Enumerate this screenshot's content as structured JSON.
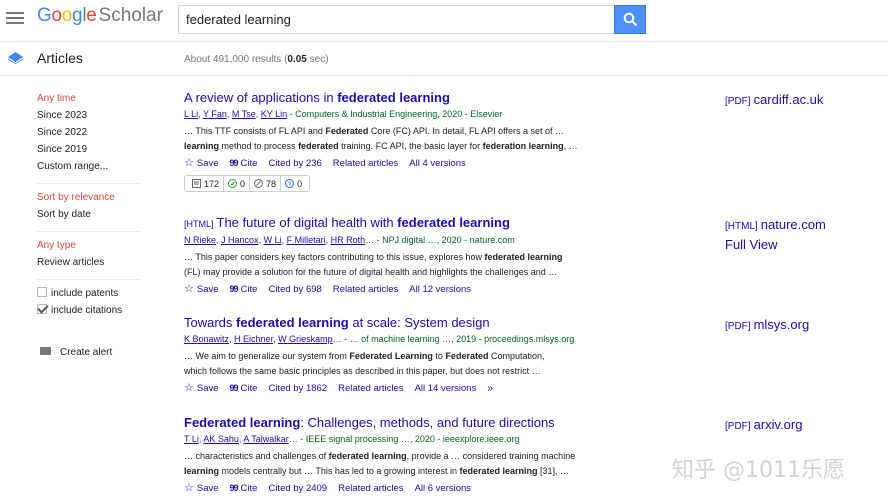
{
  "header": {
    "logo_google": "Google",
    "logo_scholar": "Scholar",
    "search_value": "federated learning"
  },
  "subheader": {
    "section": "Articles",
    "results_prefix": "About 491,000 results (",
    "results_time": "0.05",
    "results_suffix": " sec)"
  },
  "sidebar": {
    "time": [
      "Any time",
      "Since 2023",
      "Since 2022",
      "Since 2019",
      "Custom range..."
    ],
    "sort": [
      "Sort by relevance",
      "Sort by date"
    ],
    "type": [
      "Any type",
      "Review articles"
    ],
    "include_patents": "include patents",
    "include_citations": "include citations",
    "create_alert": "Create alert"
  },
  "results": [
    {
      "tag": "",
      "title_pre": "A review of applications in ",
      "title_bold": "federated learning",
      "title_post": "",
      "authors": [
        "L Li",
        "Y Fan",
        "M Tse",
        "KY Lin"
      ],
      "source": " - Computers & Industrial Engineering, 2020 - Elsevier",
      "snippet1": "… This TTF consists of FL API and Federated Core (FC) API. In detail, FL API offers a set of …",
      "snippet2": "learning method to process federated training. FC API, the basic layer for federation learning, …",
      "cited": "Cited by 236",
      "versions": "All 4 versions",
      "side_tag": "[PDF]",
      "side_site": "cardiff.ac.uk",
      "side_extra": ""
    },
    {
      "tag": "[HTML]",
      "title_pre": "The future of digital health with ",
      "title_bold": "federated learning",
      "title_post": "",
      "authors": [
        "N Rieke",
        "J Hancox",
        "W Li",
        "F Milletari",
        "HR Roth"
      ],
      "source": "… - NPJ digital …, 2020 - nature.com",
      "snippet1": "… This paper considers key factors contributing to this issue, explores how federated learning",
      "snippet2": "(FL) may provide a solution for the future of digital health and highlights the challenges and …",
      "cited": "Cited by 698",
      "versions": "All 12 versions",
      "side_tag": "[HTML]",
      "side_site": "nature.com",
      "side_extra": "Full View"
    },
    {
      "tag": "",
      "title_pre": "Towards ",
      "title_bold": "federated learning",
      "title_post": " at scale: System design",
      "authors": [
        "K Bonawitz",
        "H Eichner",
        "W Grieskamp"
      ],
      "source": "… - … of machine learning …, 2019 - proceedings.mlsys.org",
      "snippet1": "… We aim to generalize our system from Federated Learning to Federated Computation,",
      "snippet2": "which follows the same basic principles as described in this paper, but does not restrict …",
      "cited": "Cited by 1862",
      "versions": "All 14 versions",
      "side_tag": "[PDF]",
      "side_site": "mlsys.org",
      "side_extra": ""
    },
    {
      "tag": "",
      "title_pre": "",
      "title_bold": "Federated learning",
      "title_post": ": Challenges, methods, and future directions",
      "authors": [
        "T Li",
        "AK Sahu",
        "A Talwalkar"
      ],
      "source": "… - IEEE signal processing …, 2020 - ieeexplore.ieee.org",
      "snippet1": "… characteristics and challenges of federated learning, provide a … considered training machine",
      "snippet2": "learning models centrally but … This has led to a growing interest in federated learning [31], …",
      "cited": "Cited by 2409",
      "versions": "All 6 versions",
      "side_tag": "[PDF]",
      "side_site": "arxiv.org",
      "side_extra": ""
    }
  ],
  "actions": {
    "save": "Save",
    "cite": "Cite",
    "related": "Related articles"
  },
  "badges": [
    "172",
    "0",
    "78",
    "0"
  ],
  "watermark": "知乎 @1011乐愿"
}
